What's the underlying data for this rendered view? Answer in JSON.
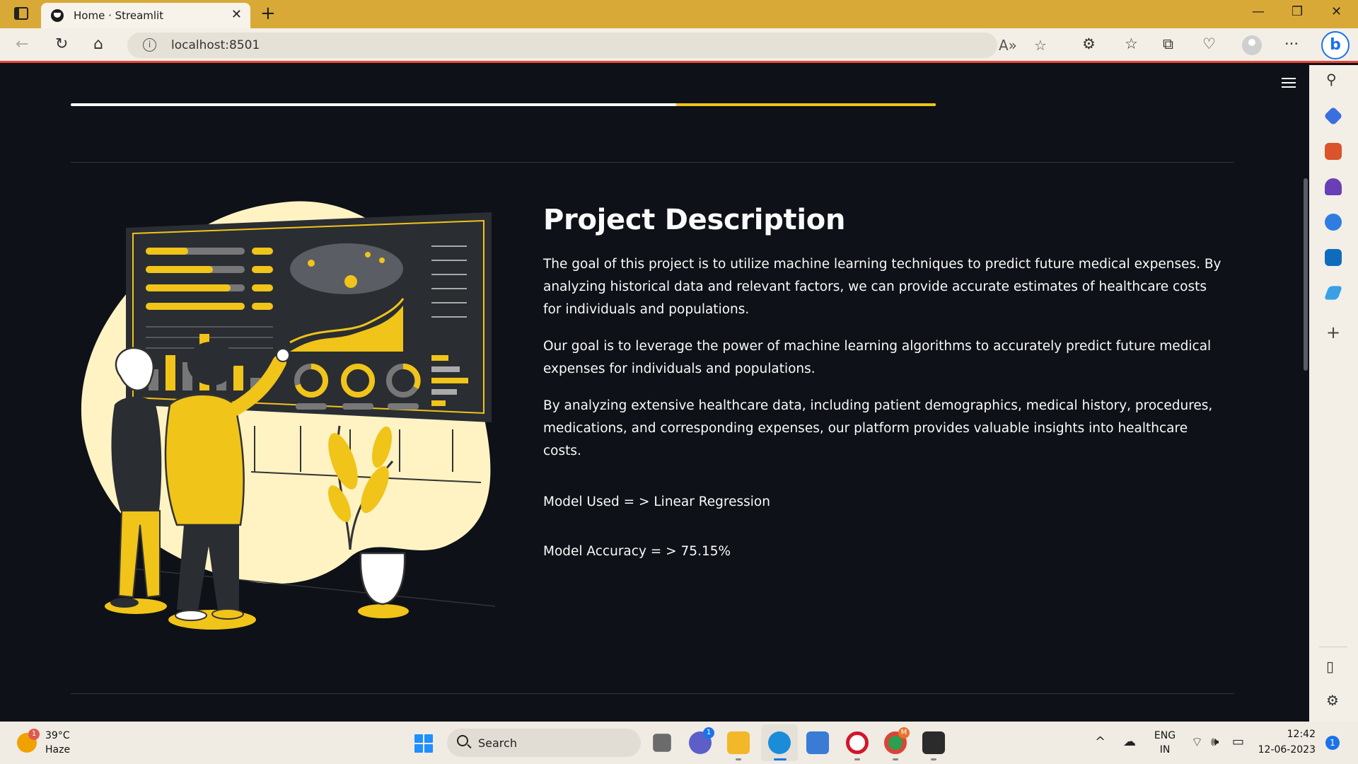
{
  "browser": {
    "tab_title": "Home · Streamlit",
    "url": "localhost:8501"
  },
  "page": {
    "progress_percent": 70,
    "heading": "Project Description",
    "paragraphs": [
      "The goal of this project is to utilize machine learning techniques to predict future medical expenses. By analyzing historical data and relevant factors, we can provide accurate estimates of healthcare costs for individuals and populations.",
      "Our goal is to leverage the power of machine learning algorithms to accurately predict future medical expenses for individuals and populations.",
      "By analyzing extensive healthcare data, including patient demographics, medical history, procedures, medications, and corresponding expenses, our platform provides valuable insights into healthcare costs."
    ],
    "model_used": "Model Used = > Linear Regression",
    "model_accuracy": "Model Accuracy = > 75.15%"
  },
  "taskbar": {
    "weather_temp": "39°C",
    "weather_desc": "Haze",
    "weather_badge": "1",
    "search_placeholder": "Search",
    "teams_badge": "1",
    "chrome_badge": "M",
    "lang_top": "ENG",
    "lang_bottom": "IN",
    "time": "12:42",
    "date": "12-06-2023",
    "notification_count": "1"
  },
  "colors": {
    "accent_yellow": "#f0c419",
    "page_bg": "#0e1117",
    "title_bar": "#d9a937"
  }
}
